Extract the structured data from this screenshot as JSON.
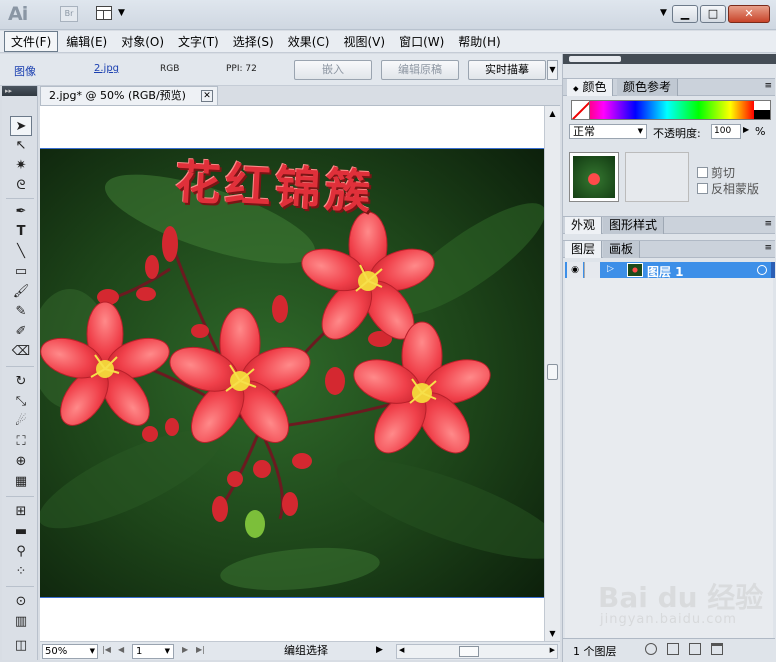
{
  "app": {
    "logo": "Ai",
    "bridge_label": "Br"
  },
  "window_controls": {
    "minimize": "▁",
    "maximize": "□",
    "close": "✕"
  },
  "menu": [
    "文件(F)",
    "编辑(E)",
    "对象(O)",
    "文字(T)",
    "选择(S)",
    "效果(C)",
    "视图(V)",
    "窗口(W)",
    "帮助(H)"
  ],
  "control_bar": {
    "object_type": "图像",
    "file_link": "2.jpg",
    "color_mode": "RGB",
    "ppi": "PPI: 72",
    "embed_button": "嵌入",
    "edit_original_button": "编辑原稿",
    "live_trace_button": "实时描摹"
  },
  "document": {
    "tab_title": "2.jpg* @ 50% (RGB/预览)",
    "tab_close": "✕",
    "artwork_text": "花红锦簇"
  },
  "status_bar": {
    "zoom": "50%",
    "page": "1",
    "status_text": "编组选择"
  },
  "panels": {
    "color_tabs": [
      "颜色",
      "颜色参考"
    ],
    "blend_mode": "正常",
    "opacity_label": "不透明度:",
    "opacity_value": "100",
    "opacity_unit": "%",
    "clip_label": "剪切",
    "invert_mask_label": "反相蒙版",
    "appearance_tabs": [
      "外观",
      "图形样式"
    ],
    "layers_tabs": [
      "图层",
      "画板"
    ],
    "layer_name": "图层 1",
    "layers_count": "1 个图层"
  },
  "watermark": {
    "brand": "Bai du 经验",
    "url": "jingyan.baidu.com"
  }
}
